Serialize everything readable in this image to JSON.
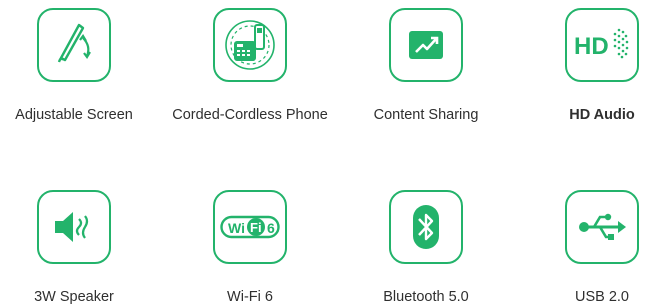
{
  "features": [
    {
      "label": "Adjustable Screen",
      "icon": "adjustable-screen-icon"
    },
    {
      "label": "Corded-Cordless Phone",
      "icon": "corded-cordless-phone-icon"
    },
    {
      "label": "Content Sharing",
      "icon": "content-sharing-icon"
    },
    {
      "label": "HD Audio",
      "icon": "hd-audio-icon",
      "icon_text": "HD"
    },
    {
      "label": "3W Speaker",
      "icon": "speaker-icon"
    },
    {
      "label": "Wi-Fi 6",
      "icon": "wifi-6-icon",
      "icon_text_a": "Wi",
      "icon_text_b": "Fi",
      "icon_text_c": "6"
    },
    {
      "label": "Bluetooth 5.0",
      "icon": "bluetooth-icon"
    },
    {
      "label": "USB 2.0",
      "icon": "usb-icon"
    }
  ],
  "colors": {
    "accent": "#23b36b",
    "text": "#2f2f2f",
    "background": "#ffffff"
  }
}
